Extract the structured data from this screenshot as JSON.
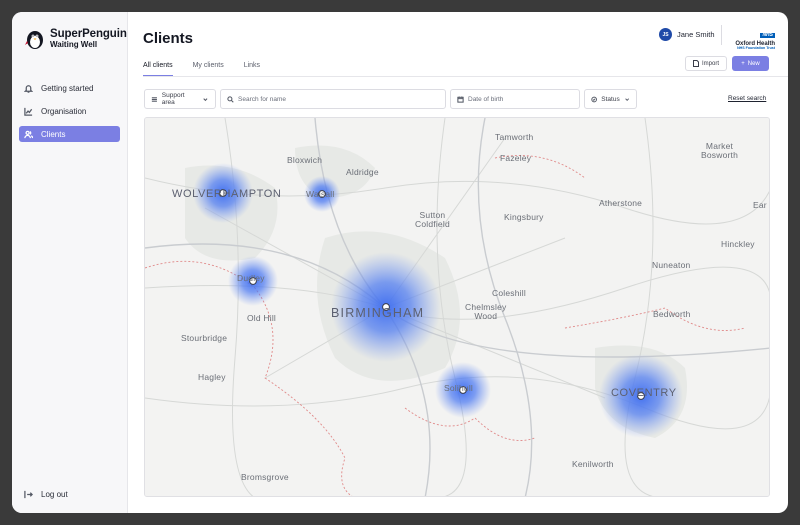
{
  "brand": {
    "name": "SuperPenguin",
    "subtitle": "Waiting Well"
  },
  "sidebar": {
    "items": [
      {
        "label": "Getting started",
        "icon": "bell-icon"
      },
      {
        "label": "Organisation",
        "icon": "chart-icon"
      },
      {
        "label": "Clients",
        "icon": "users-icon",
        "active": true
      }
    ],
    "logout": "Log out"
  },
  "header": {
    "title": "Clients",
    "user": {
      "initials": "JS",
      "name": "Jane Smith"
    },
    "org": {
      "badge": "NHS",
      "name": "Oxford Health",
      "trust": "NHS Foundation Trust"
    }
  },
  "tabs": [
    "All clients",
    "My clients",
    "Links"
  ],
  "actions": {
    "import": "Import",
    "new": "New"
  },
  "filters": {
    "support_area": "Support area",
    "search_placeholder": "Search for name",
    "dob": "Date of birth",
    "status": "Status",
    "reset": "Reset search"
  },
  "map": {
    "labels": [
      "Tamworth",
      "Fazeley",
      "Market Bosworth",
      "Bloxwich",
      "Aldridge",
      "WOLVERHAMPTON",
      "Walsall",
      "Sutton Coldfield",
      "Kingsbury",
      "Atherstone",
      "Ear",
      "Hinckley",
      "Dudley",
      "Nuneaton",
      "Coleshill",
      "BIRMINGHAM",
      "Old Hill",
      "Chelmsley Wood",
      "Bedworth",
      "Stourbridge",
      "Hagley",
      "Solihull",
      "COVENTRY",
      "Kenilworth",
      "Bromsgrove"
    ]
  },
  "colors": {
    "accent": "#7b7fe3",
    "heat": "#3b6bf0",
    "nhs": "#005eb8"
  }
}
